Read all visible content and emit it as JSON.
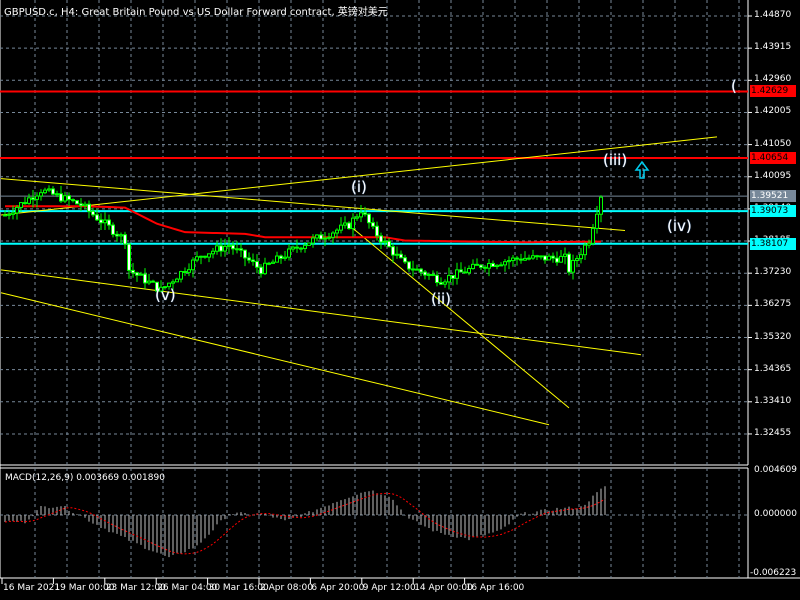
{
  "header": {
    "title": "GBPUSD.c, H4:  Great Britain Pound vs US Dollar Forward contract, 英镑对美元"
  },
  "macd": {
    "label": "MACD(12,26,9) 0.003669 0.001890",
    "axis": [
      "0.004609",
      "0.000000",
      "-0.006223"
    ]
  },
  "price_axis": [
    "1.44870",
    "1.43915",
    "1.42960",
    "1.42005",
    "1.41050",
    "1.40095",
    "1.39140",
    "1.38185",
    "1.37230",
    "1.36275",
    "1.35320",
    "1.34365",
    "1.33410",
    "1.32455"
  ],
  "price_tags": [
    {
      "text": "1.42629",
      "price": 1.42629,
      "color": "#ff0000",
      "line": true
    },
    {
      "text": "1.40654",
      "price": 1.40654,
      "color": "#ff0000",
      "line": true
    },
    {
      "text": "1.39521",
      "price": 1.39521,
      "color": "#778899",
      "line": true
    },
    {
      "text": "1.39073",
      "price": 1.39073,
      "color": "#00ffff",
      "line": true
    },
    {
      "text": "1.38107",
      "price": 1.38107,
      "color": "#00ffff",
      "line": true
    }
  ],
  "time_axis": [
    "16 Mar 2021",
    "19 Mar 00:00",
    "23 Mar 12:00",
    "26 Mar 04:00",
    "30 Mar 16:00",
    "2 Apr 08:00",
    "6 Apr 20:00",
    "9 Apr 12:00",
    "14 Apr 00:00",
    "16 Apr 16:00"
  ],
  "waves": [
    {
      "text": "(v)",
      "bar": 40,
      "price": 1.3655
    },
    {
      "text": "(i)",
      "bar": 89,
      "price": 1.3975
    },
    {
      "text": "(ii)",
      "bar": 109,
      "price": 1.3645
    },
    {
      "text": "(iii)",
      "bar": 152,
      "price": 1.4055
    },
    {
      "text": "(iv)",
      "bar": 168,
      "price": 1.386
    },
    {
      "text": "(",
      "bar": 184,
      "price": 1.4275
    }
  ],
  "colors": {
    "bull": "#00ff00",
    "bear": "#ffffff",
    "ma": "#ff0000",
    "trend": "#ffff00",
    "grid": "#778899",
    "arrow": "#00ccee"
  },
  "chart_data": {
    "type": "candlestick",
    "symbol": "GBPUSD.c",
    "timeframe": "H4",
    "ylim": [
      1.3192,
      1.4534
    ],
    "close_keypoints": [
      [
        0,
        1.3896
      ],
      [
        9,
        1.397
      ],
      [
        19,
        1.3926
      ],
      [
        30,
        1.3822
      ],
      [
        31,
        1.3733
      ],
      [
        39,
        1.3673
      ],
      [
        49,
        1.3777
      ],
      [
        56,
        1.3807
      ],
      [
        64,
        1.3733
      ],
      [
        74,
        1.3807
      ],
      [
        86,
        1.3866
      ],
      [
        89,
        1.3911
      ],
      [
        92,
        1.3851
      ],
      [
        100,
        1.3747
      ],
      [
        109,
        1.3703
      ],
      [
        119,
        1.3747
      ],
      [
        129,
        1.3768
      ],
      [
        140,
        1.3768
      ],
      [
        141,
        1.3733
      ],
      [
        146,
        1.3822
      ],
      [
        149,
        1.3955
      ]
    ],
    "ma_keypoints": [
      [
        0,
        1.3922
      ],
      [
        20,
        1.3922
      ],
      [
        30,
        1.3918
      ],
      [
        38,
        1.387
      ],
      [
        45,
        1.3845
      ],
      [
        60,
        1.384
      ],
      [
        65,
        1.383
      ],
      [
        95,
        1.383
      ],
      [
        100,
        1.382
      ],
      [
        130,
        1.3815
      ],
      [
        149,
        1.3817
      ]
    ],
    "trendlines": [
      [
        -1,
        1.4004,
        155,
        1.385
      ],
      [
        -1,
        1.3896,
        178,
        1.4128
      ],
      [
        -1,
        1.3733,
        159,
        1.3481
      ],
      [
        -1,
        1.3665,
        136,
        1.3273
      ],
      [
        86,
        1.3866,
        141,
        1.3323
      ]
    ],
    "macd_keypoints": [
      [
        0,
        -0.0008
      ],
      [
        5,
        -0.0009
      ],
      [
        9,
        0.001
      ],
      [
        14,
        0.0012
      ],
      [
        18,
        0.0002
      ],
      [
        22,
        -0.001
      ],
      [
        30,
        -0.003
      ],
      [
        41,
        -0.0055
      ],
      [
        48,
        -0.004
      ],
      [
        56,
        0.0002
      ],
      [
        65,
        0.0001
      ],
      [
        70,
        -0.0008
      ],
      [
        76,
        0.0003
      ],
      [
        84,
        0.002
      ],
      [
        91,
        0.0032
      ],
      [
        96,
        0.0025
      ],
      [
        101,
        -0.0005
      ],
      [
        108,
        -0.0022
      ],
      [
        116,
        -0.0031
      ],
      [
        124,
        -0.002
      ],
      [
        129,
        0.0001
      ],
      [
        138,
        0.0008
      ],
      [
        144,
        0.001
      ],
      [
        150,
        0.0037
      ]
    ],
    "macd_ylim": [
      -0.006223,
      0.004609
    ]
  }
}
